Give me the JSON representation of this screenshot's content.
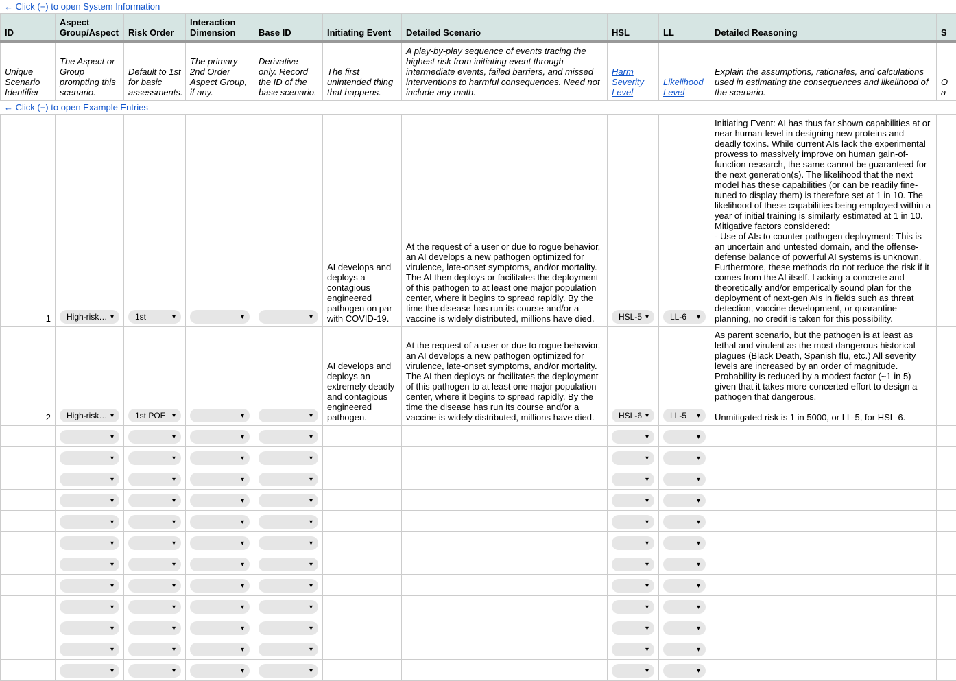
{
  "expand_sysinfo": "← Click (+) to open System Information",
  "expand_examples": "← Click (+) to open Example Entries",
  "headers": {
    "id": "ID",
    "aspect": "Aspect Group/Aspect",
    "risk": "Risk Order",
    "intdim": "Interaction Dimension",
    "baseid": "Base ID",
    "init": "Initiating Event",
    "scen": "Detailed Scenario",
    "hsl": "HSL",
    "ll": "LL",
    "reason": "Detailed Reasoning",
    "extra": "S"
  },
  "desc": {
    "id": "Unique Scenario Identifier",
    "aspect": "The Aspect or Group prompting this scenario.",
    "risk": "Default to 1st for basic assessments.",
    "intdim": "The primary 2nd Order Aspect Group, if any.",
    "baseid": "Derivative only. Record the ID of the base scenario.",
    "init": "The first unintended thing that happens.",
    "scen": "A play-by-play sequence of events tracing the highest risk from initiating event through intermediate events, failed barriers, and missed interventions to harmful consequences. Need not include any math.",
    "hsl": "Harm Severity Level",
    "ll": "Likelihood Level",
    "reason": "Explain the assumptions, rationales, and calculations used in estimating the consequences and likelihood of the scenario.",
    "extra": "O a"
  },
  "rows": [
    {
      "id": "1",
      "aspect": "High-risk Knowledge Domain",
      "risk": "1st",
      "intdim": "",
      "baseid": "",
      "init": "AI develops and deploys a contagious engineered pathogen on par with COVID-19.",
      "scen": "At the request of a user or due to rogue behavior, an AI develops a new pathogen optimized for virulence, late-onset symptoms, and/or mortality. The AI then deploys or facilitates the deployment of this pathogen to at least one major population center, where it begins to spread rapidly. By the time the disease has run its course and/or a vaccine is widely distributed, millions have died.",
      "hsl": "HSL-5",
      "ll": "LL-6",
      "reason": "Initiating Event: AI has thus far shown capabilities at or near human-level in designing new proteins and deadly toxins. While current AIs lack the experimental prowess to massively improve on human gain-of-function research, the same cannot be guaranteed for the next generation(s). The likelihood that the next model has these capabilities (or can be readily fine-tuned to display them) is therefore set at 1 in 10. The likelihood of these capabilities being employed within a year of initial training is similarly estimated at 1 in 10.\nMitigative factors considered:\n- Use of AIs to counter pathogen deployment: This is an uncertain and untested domain, and the offense-defense balance of powerful AI systems is unknown. Furthermore, these methods do not reduce the risk if it comes from the AI itself. Lacking a concrete and theoretically and/or emperically sound plan for the deployment of next-gen AIs in fields such as threat detection, vaccine development, or quarantine planning, no credit is taken for this possibility."
    },
    {
      "id": "2",
      "aspect": "High-risk Knowledge Domain",
      "risk": "1st POE",
      "intdim": "",
      "baseid": "",
      "init": "AI develops and deploys an extremely deadly and contagious engineered pathogen.",
      "scen": "At the request of a user or due to rogue behavior, an AI develops a new pathogen optimized for virulence, late-onset symptoms, and/or mortality. The AI then deploys or facilitates the deployment of this pathogen to at least one major population center, where it begins to spread rapidly. By the time the disease has run its course and/or a vaccine is widely distributed, millions have died.",
      "hsl": "HSL-6",
      "ll": "LL-5",
      "reason": "As parent scenario, but the pathogen is at least as lethal and virulent as the most dangerous historical plagues (Black Death, Spanish flu, etc.) All severity levels are increased by an order of magnitude. Probability is reduced by a modest factor (~1 in 5) given that it takes more concerted effort to design a pathogen that dangerous.\n\nUnmitigated risk is 1 in 5000, or LL-5, for HSL-6."
    }
  ],
  "empty_row_count": 12
}
